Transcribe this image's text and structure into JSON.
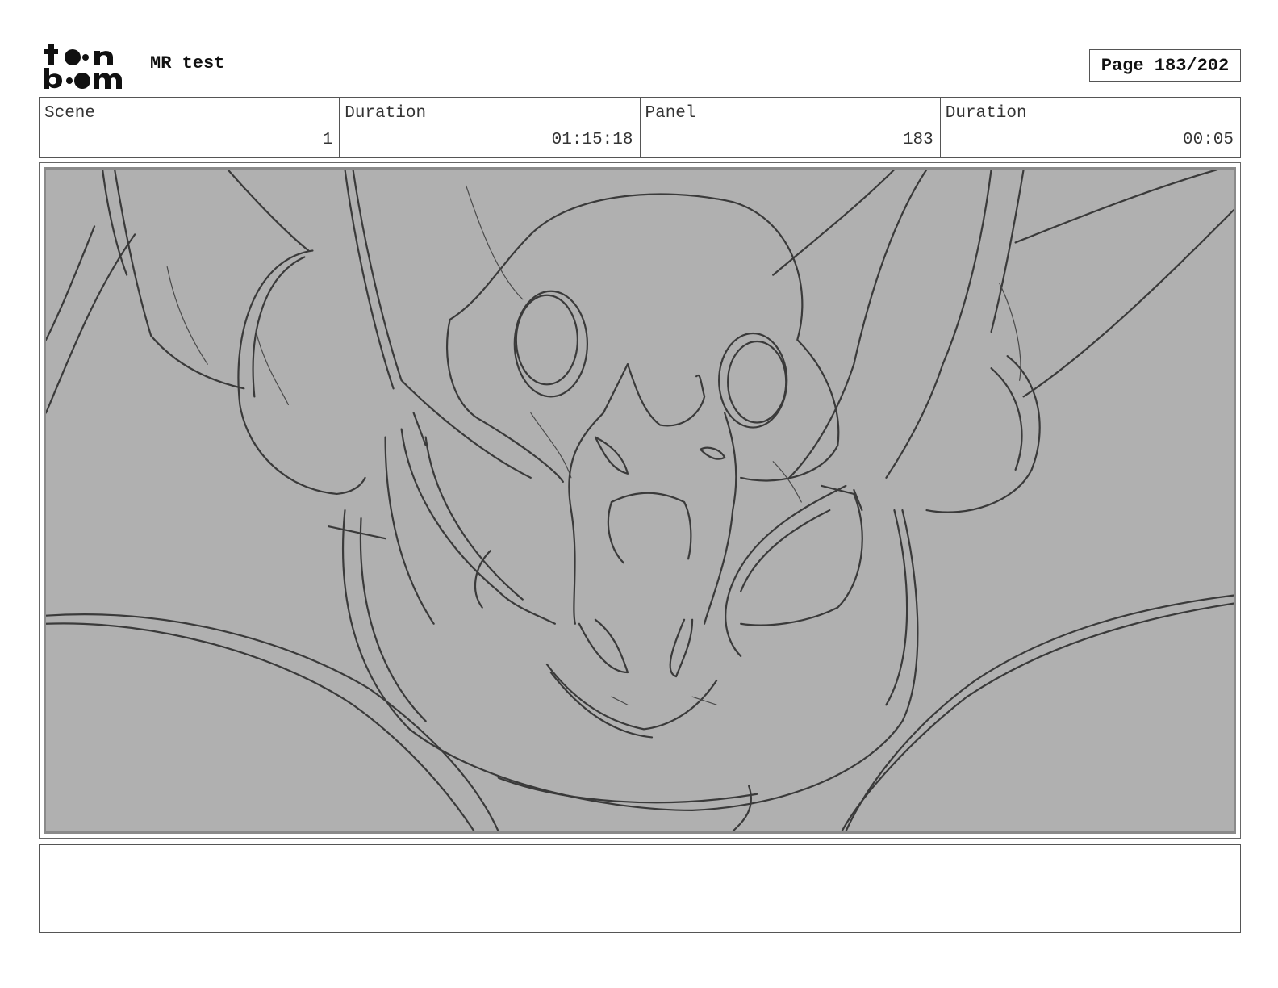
{
  "header": {
    "logo_text": "toonboom",
    "project_title": "MR test",
    "page_indicator": "Page 183/202"
  },
  "info": [
    {
      "label": "Scene",
      "value": "1"
    },
    {
      "label": "Duration",
      "value": "01:15:18"
    },
    {
      "label": "Panel",
      "value": "183"
    },
    {
      "label": "Duration",
      "value": "00:05"
    }
  ],
  "panel": {
    "image_icon": "storyboard-sketch",
    "background_color": "#b0b0b0",
    "line_color": "#3a3a3a"
  },
  "notes": {
    "text": ""
  }
}
